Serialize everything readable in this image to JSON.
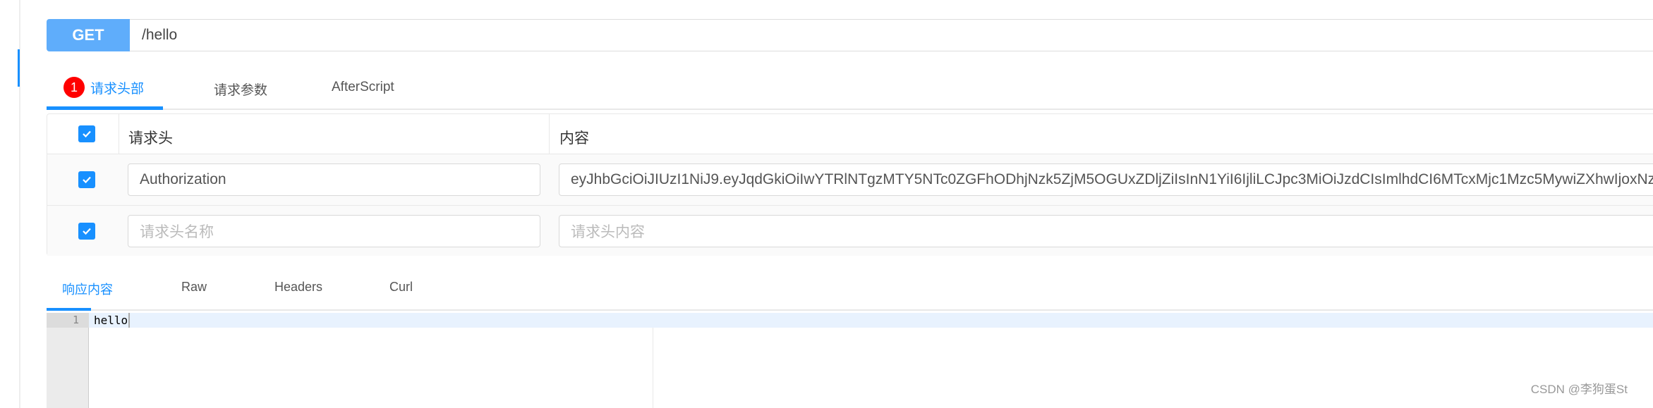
{
  "request": {
    "method": "GET",
    "url": "/hello",
    "method_color": "#5fadfb"
  },
  "request_tabs": [
    {
      "label": "请求头部",
      "badge": "1",
      "active": true
    },
    {
      "label": "请求参数",
      "active": false
    },
    {
      "label": "AfterScript",
      "active": false
    }
  ],
  "headers_table": {
    "columns": [
      "请求头",
      "内容"
    ],
    "rows": [
      {
        "checked": true,
        "name": "Authorization",
        "value": "eyJhbGciOiJIUzI1NiJ9.eyJqdGkiOiIwYTRlNTgzMTY5NTc0ZGFhODhjNzk5ZjM5OGUxZDljZiIsInN1YiI6IjliLCJpc3MiOiJzdCIsImlhdCI6MTcxMjc1Mzc5MywiZXhwIjoxNz"
      },
      {
        "checked": true,
        "name_placeholder": "请求头名称",
        "value_placeholder": "请求头内容"
      }
    ]
  },
  "response_tabs": [
    {
      "label": "响应内容",
      "active": true
    },
    {
      "label": "Raw",
      "active": false
    },
    {
      "label": "Headers",
      "active": false
    },
    {
      "label": "Curl",
      "active": false
    }
  ],
  "response": {
    "line_number": "1",
    "content": "hello"
  },
  "accent_color": "#1890ff",
  "watermark": "CSDN @李狗蛋St"
}
